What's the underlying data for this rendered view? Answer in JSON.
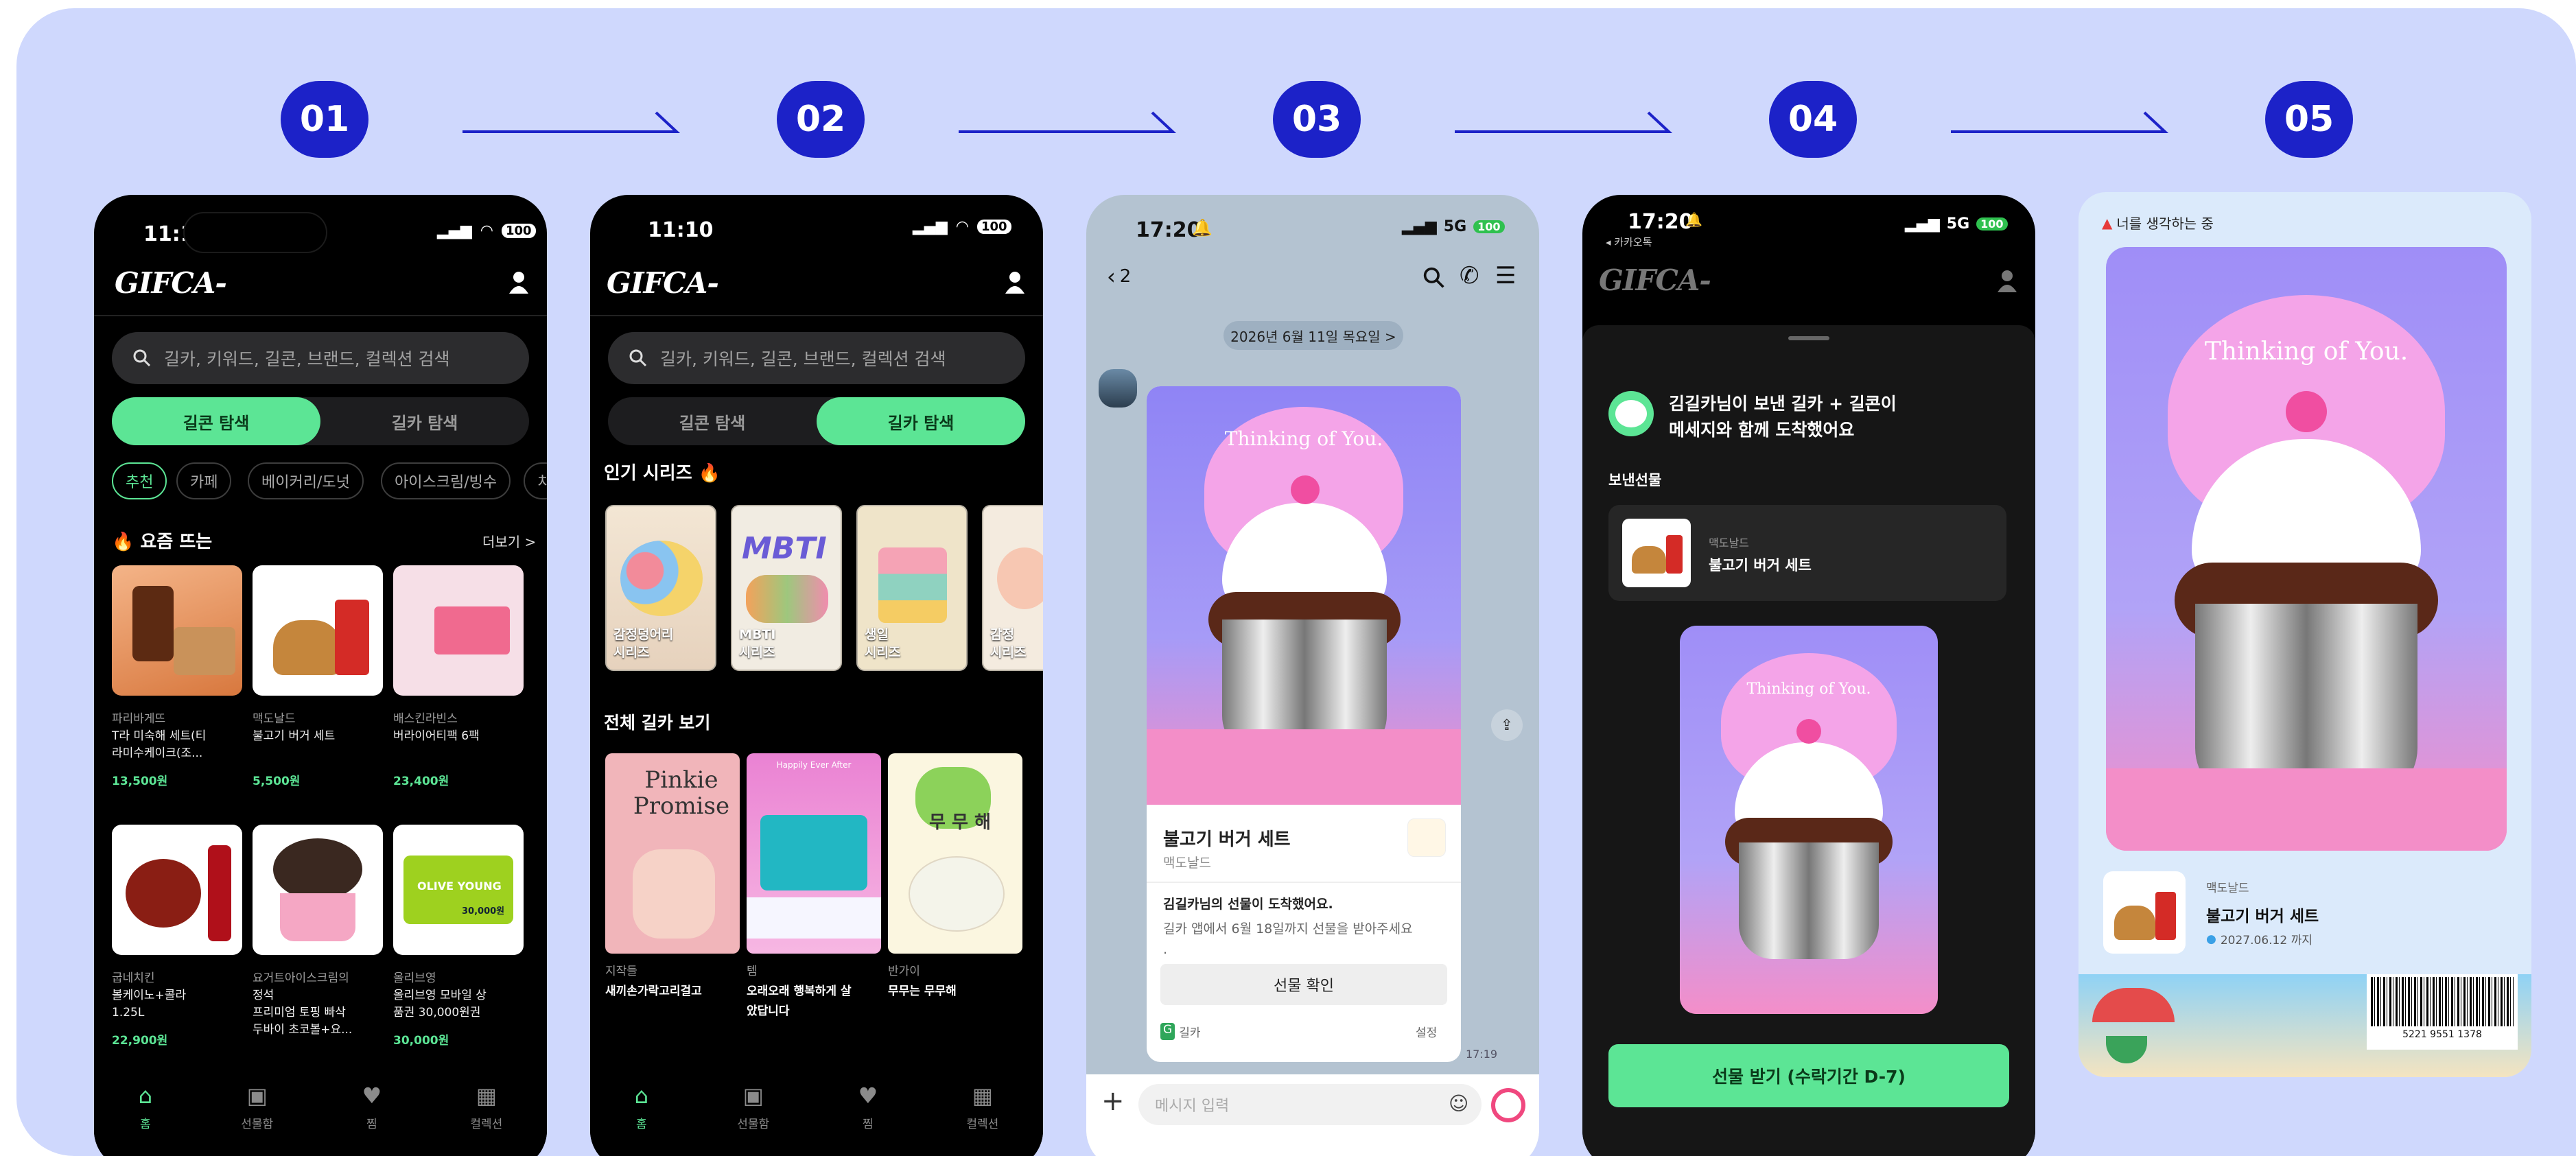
{
  "steps": [
    "01",
    "02",
    "03",
    "04",
    "05"
  ],
  "colors": {
    "accent": "#5ce595",
    "step_badge": "#1c22c8",
    "background": "#cfd8fd"
  },
  "screen1": {
    "time": "11:10",
    "battery": "100",
    "logo": "GIFCA-",
    "search_placeholder": "길카, 키워드, 길콘, 브랜드, 컬렉션 검색",
    "seg": [
      "길콘 탐색",
      "길카 탐색"
    ],
    "chips": [
      "추천",
      "카페",
      "베이커리/도넛",
      "아이스크림/빙수",
      "치"
    ],
    "section": "🔥 요즘 뜨는",
    "more": "더보기 >",
    "products": [
      {
        "brand": "파리바게뜨",
        "name1": "T라 미숙해 세트(티",
        "name2": "라미수케이크(조...",
        "price": "13,500원"
      },
      {
        "brand": "맥도날드",
        "name1": "불고기 버거 세트",
        "name2": "",
        "price": "5,500원"
      },
      {
        "brand": "배스킨라빈스",
        "name1": "버라이어티팩 6팩",
        "name2": "",
        "price": "23,400원"
      },
      {
        "brand": "굽네치킨",
        "name1": "볼케이노+콜라",
        "name2": "1.25L",
        "price": "22,900원"
      },
      {
        "brand": "요거트아이스크림의",
        "name1": "정석",
        "name2": "프리미엄 토핑 빠삭",
        "name3": "두바이 초코볼+요...",
        "price": ""
      },
      {
        "brand": "올리브영",
        "name1": "올리브영 모바일 상",
        "name2": "품권 30,000원권",
        "price": "30,000원"
      }
    ],
    "olive_text": "OLIVE YOUNG",
    "olive_amount": "30,000원",
    "tabs": [
      "홈",
      "선물함",
      "찜",
      "컬렉션"
    ]
  },
  "screen2": {
    "time": "11:10",
    "battery": "100",
    "logo": "GIFCA-",
    "search_placeholder": "길카, 키워드, 길콘, 브랜드, 컬렉션 검색",
    "seg": [
      "길콘 탐색",
      "길카 탐색"
    ],
    "popular": "인기 시리즈 🔥",
    "series": [
      {
        "l1": "감정덩어리",
        "l2": "시리즈"
      },
      {
        "l1": "MBTI",
        "l2": "시리즈",
        "art": "MBTI"
      },
      {
        "l1": "생일",
        "l2": "시리즈"
      },
      {
        "l1": "감정",
        "l2": "시리즈"
      }
    ],
    "all": "전체 길카 보기",
    "cards": [
      {
        "art": "Pinkie Promise",
        "tag": "지작들",
        "title": "새끼손가락고리걸고"
      },
      {
        "art": "Happily Ever After",
        "tag": "템",
        "title": "오래오래 행복하게 살",
        "title2": "았답니다"
      },
      {
        "art": "무 무 해",
        "tag": "반가이",
        "title": "무무는 무무해"
      }
    ],
    "tabs": [
      "홈",
      "선물함",
      "찜",
      "컬렉션"
    ]
  },
  "screen3": {
    "time": "17:20",
    "network": "5G",
    "battery": "100",
    "back_count": "2",
    "date_pill": "2026년 6월 11일 목요일 >",
    "card_text": "Thinking of You.",
    "product": "불고기 버거 세트",
    "brand": "맥도날드",
    "msg1": "김길카님의 선물이 도착했어요.",
    "msg2": "길카 앱에서 6월 18일까지 선물을 받아주세요",
    "msg3": ".",
    "confirm": "선물 확인",
    "footer_app": "길카",
    "footer_setting": "설정",
    "msg_time": "17:19",
    "input_placeholder": "메시지 입력"
  },
  "screen4": {
    "time": "17:20",
    "back_label": "◂ 카카오톡",
    "network": "5G",
    "battery": "100",
    "logo": "GIFCA-",
    "title1": "김길카님이 보낸 길카 + 길콘이",
    "title2": "메세지와 함께 도착했어요",
    "sent_label": "보낸선물",
    "brand": "맥도날드",
    "product": "불고기 버거 세트",
    "card_text": "Thinking of You.",
    "receive_button": "선물 받기 (수락기간 D-7)"
  },
  "screen5": {
    "top_label": "너를 생각하는 중",
    "card_text": "Thinking of You.",
    "brand": "맥도날드",
    "product": "불고기 버거 세트",
    "expiry": "2027.06.12 까지",
    "barcode_number": "5221 9551 1378"
  }
}
